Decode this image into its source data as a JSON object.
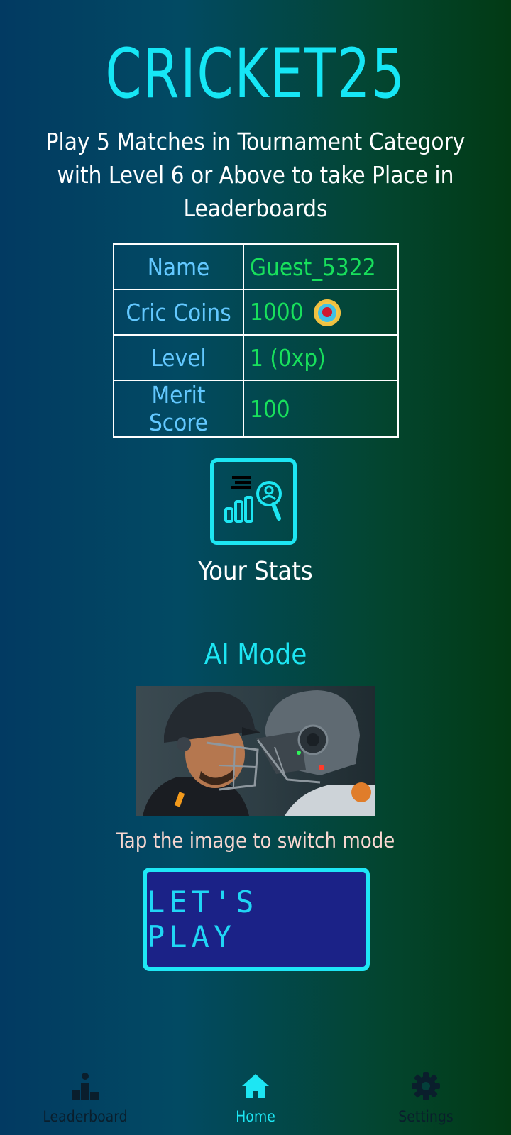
{
  "app": {
    "title": "CRICKET25"
  },
  "notice": "Play 5 Matches in Tournament Category with Level 6 or Above to take Place in Leaderboards",
  "profile": {
    "rows": [
      {
        "label": "Name",
        "value": "Guest_5322"
      },
      {
        "label": "Cric Coins",
        "value": "1000",
        "icon": "coin-icon"
      },
      {
        "label": "Level",
        "value": "1 (0xp)"
      },
      {
        "label": "Merit Score",
        "value": "100"
      }
    ]
  },
  "stats": {
    "label": "Your Stats",
    "icon": "stats-icon"
  },
  "mode": {
    "title": "AI Mode",
    "hint": "Tap the image to switch mode",
    "image": "human-vs-robot-cricketer-image"
  },
  "play_button": {
    "label": "LET'S PLAY"
  },
  "nav": {
    "items": [
      {
        "label": "Leaderboard",
        "icon": "podium-icon",
        "active": false
      },
      {
        "label": "Home",
        "icon": "home-icon",
        "active": true
      },
      {
        "label": "Settings",
        "icon": "gear-icon",
        "active": false
      }
    ]
  },
  "colors": {
    "accent": "#1de6f3",
    "value_green": "#18e05c",
    "label_blue": "#63c8ff",
    "button_bg": "#1b2287",
    "nav_inactive": "#0a1e2c"
  }
}
